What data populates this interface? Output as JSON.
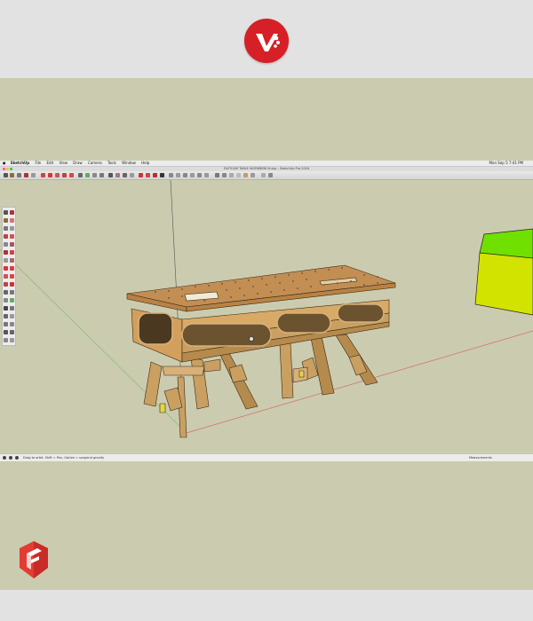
{
  "header": {
    "brand_logo": "red-circle-brand-logo"
  },
  "menubar": {
    "app_name": "SketchUp",
    "items": [
      "File",
      "Edit",
      "View",
      "Draw",
      "Camera",
      "Tools",
      "Window",
      "Help"
    ],
    "clock": "Mon Sep 5  7:41 PM"
  },
  "window": {
    "title": "FASTCAM TABLE WORKBENCH.skp - SketchUp Pro 2016"
  },
  "statusbar": {
    "hint": "Drag to orbit. Shift = Pan, Option = suspend gravity",
    "measurements_label": "Measurements"
  },
  "footer": {
    "app_logo": "sketchup-logo"
  },
  "colors": {
    "brand_red": "#d61f26",
    "background": "#cbcbaf",
    "wood": "#c9a062",
    "green_box_top": "#6fe000",
    "green_box_side": "#d2e300"
  }
}
